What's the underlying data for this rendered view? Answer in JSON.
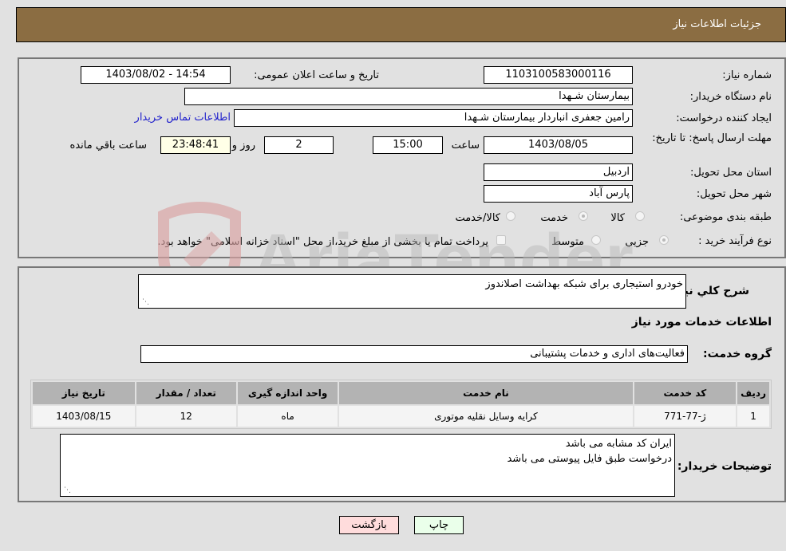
{
  "header": {
    "title": "جزئیات اطلاعات نیاز"
  },
  "need_info": {
    "need_number_label": "شماره نیاز:",
    "need_number": "1103100583000116",
    "announce_label": "تاریخ و ساعت اعلان عمومی:",
    "announce_value": "1403/08/02 - 14:54",
    "buyer_org_label": "نام دستگاه خریدار:",
    "buyer_org": "بیمارستان شـهدا",
    "creator_label": "ایجاد کننده درخواست:",
    "creator": "رامین جعفری انباردار بیمارستان شـهدا",
    "contact_link": "اطلاعات تماس خریدار",
    "deadline_label": "مهلت ارسال پاسخ: تا تاریخ:",
    "deadline_date": "1403/08/05",
    "time_label": "ساعت",
    "deadline_time": "15:00",
    "days_value": "2",
    "days_label": "روز و",
    "remaining_time": "23:48:41",
    "remaining_label": "ساعت باقي مانده",
    "province_label": "استان محل تحویل:",
    "province": "اردبیل",
    "city_label": "شهر محل تحویل:",
    "city": "پارس آباد",
    "category_label": "طبقه بندی موضوعی:",
    "category_options": [
      {
        "label": "کالا",
        "selected": false
      },
      {
        "label": "خدمت",
        "selected": true
      },
      {
        "label": "کالا/خدمت",
        "selected": false
      }
    ],
    "process_label": "نوع فرآیند خرید :",
    "process_options": [
      {
        "label": "جزيي",
        "selected": true
      },
      {
        "label": "متوسط",
        "selected": false
      }
    ],
    "treasury_note": "پرداخت تمام یا بخشی از مبلغ خرید،از محل \"اسناد خزانه اسلامی\" خواهد بود.",
    "treasury_checked": false
  },
  "details": {
    "description_label": "شرح کلي نیاز:",
    "description": "خودرو استیجاری برای شبکه بهداشت اصلاندوز",
    "services_heading": "اطلاعات خدمات مورد نیاز",
    "service_group_label": "گروه خدمت:",
    "service_group": "فعالیت‌های اداری و خدمات پشتیبانی",
    "table": {
      "headers": [
        "ردیف",
        "کد خدمت",
        "نام خدمت",
        "واحد اندازه گیری",
        "تعداد / مقدار",
        "تاریخ نیاز"
      ],
      "rows": [
        [
          "1",
          "ژ-77-771",
          "کرایه وسایل نقلیه موتوری",
          "ماه",
          "12",
          "1403/08/15"
        ]
      ]
    },
    "buyer_notes_label": "توضیحات خریدار:",
    "buyer_notes_line1": "ایران کد مشابه می باشد",
    "buyer_notes_line2": "درخواست طبق فایل پیوستی می باشد"
  },
  "buttons": {
    "print": "چاپ",
    "back": "بازگشت"
  },
  "watermark": {
    "text": "AriaTender.neT"
  }
}
